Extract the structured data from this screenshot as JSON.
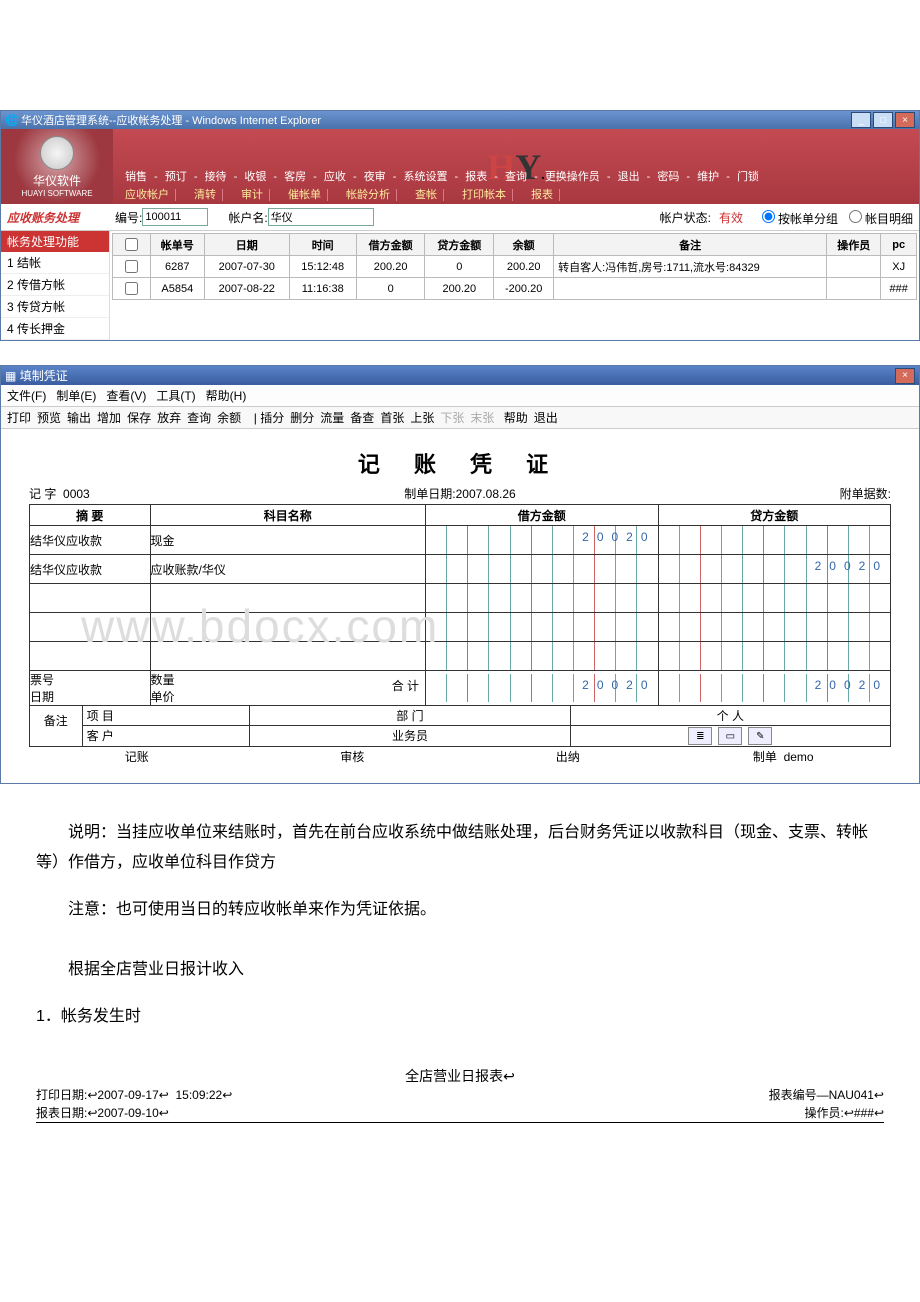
{
  "window": {
    "title": "华仪酒店管理系统--应收帐务处理 - Windows Internet Explorer"
  },
  "brand": {
    "cn": "华仪软件",
    "en": "HUAYI SOFTWARE"
  },
  "mainmenu": [
    "销售",
    "预订",
    "接待",
    "收银",
    "客房",
    "应收",
    "夜审",
    "系统设置",
    "报表",
    "查询",
    "更换操作员",
    "退出",
    "密码",
    "维护",
    "门锁"
  ],
  "submenu": [
    "应收帐户",
    "清转",
    "审计",
    "催帐单",
    "帐龄分析",
    "查帐",
    "打印帐本",
    "报表"
  ],
  "toolbar": {
    "mod": "应收账务处理",
    "num_lbl": "编号:",
    "num": "100011",
    "name_lbl": "帐户名:",
    "name": "华仪",
    "stat_lbl": "帐户状态:",
    "stat": "有效",
    "r1": "按帐单分组",
    "r2": "帐目明细"
  },
  "sidebar": {
    "hdr": "帐务处理功能",
    "items": [
      "1 结帐",
      "2 传借方帐",
      "3 传贷方帐",
      "4 传长押金"
    ]
  },
  "grid": {
    "hdrs": [
      "",
      "帐单号",
      "日期",
      "时间",
      "借方金额",
      "贷方金额",
      "余额",
      "备注",
      "操作员",
      "pc"
    ],
    "rows": [
      {
        "c": [
          "",
          "6287",
          "2007-07-30",
          "15:12:48",
          "200.20",
          "0",
          "200.20",
          "转自客人:冯伟哲,房号:1711,流水号:84329",
          "",
          "XJ"
        ]
      },
      {
        "c": [
          "",
          "A5854",
          "2007-08-22",
          "11:16:38",
          "0",
          "200.20",
          "-200.20",
          "",
          "",
          "###"
        ]
      }
    ]
  },
  "subwin": {
    "title": "填制凭证",
    "menu": [
      "文件(F)",
      "制单(E)",
      "查看(V)",
      "工具(T)",
      "帮助(H)"
    ],
    "tb": [
      "打印",
      "预览",
      "输出",
      "增加",
      "保存",
      "放弃",
      "查询",
      "余额"
    ],
    "tb2": [
      "插分",
      "删分",
      "流量",
      "备查",
      "首张",
      "上张"
    ],
    "tb_dis": [
      "下张",
      "末张"
    ],
    "tb3": [
      "帮助",
      "退出"
    ]
  },
  "voucher": {
    "title": "记 账 凭 证",
    "zi": "记    字",
    "no": "0003",
    "date_lbl": "制单日期:",
    "date": "2007.08.26",
    "att": "附单据数:",
    "h": [
      "摘 要",
      "科目名称",
      "借方金额",
      "贷方金额"
    ],
    "rows": [
      {
        "s": "结华仪应收款",
        "k": "现金",
        "d": "20020",
        "c": ""
      },
      {
        "s": "结华仪应收款",
        "k": "应收账款/华仪",
        "d": "",
        "c": "20020"
      },
      {
        "s": "",
        "k": "",
        "d": "",
        "c": ""
      },
      {
        "s": "",
        "k": "",
        "d": "",
        "c": ""
      },
      {
        "s": "",
        "k": "",
        "d": "",
        "c": ""
      }
    ],
    "sum": {
      "lbl": "合 计",
      "d": "20020",
      "c": "20020"
    },
    "left": {
      "a": "票号",
      "b": "日期"
    },
    "mid": {
      "a": "数量",
      "b": "单价"
    },
    "bz": "备注",
    "xm": "项   目",
    "kh": "客   户",
    "bm": "部   门",
    "ywy": "业务员",
    "gr": "个   人",
    "f": [
      "记账",
      "审核",
      "出纳",
      "制单"
    ],
    "fuser": "demo"
  },
  "explain": {
    "p1": "说明：当挂应收单位来结账时，首先在前台应收系统中做结账处理，后台财务凭证以收款科目（现金、支票、转帐等）作借方，应收单位科目作贷方",
    "p2": "注意：也可使用当日的转应收帐单来作为凭证依据。",
    "p3": "根据全店营业日报计收入",
    "p4": "1．帐务发生时"
  },
  "report": {
    "title": "全店营业日报表↩",
    "l1a": "打印日期:↩2007-09-17↩",
    "l1b": "15:09:22↩",
    "l1c": "报表编号—NAU041↩",
    "l2a": "报表日期:↩2007-09-10↩",
    "l2b": "操作员:↩###↩"
  },
  "watermark": "www.bdocx.com"
}
